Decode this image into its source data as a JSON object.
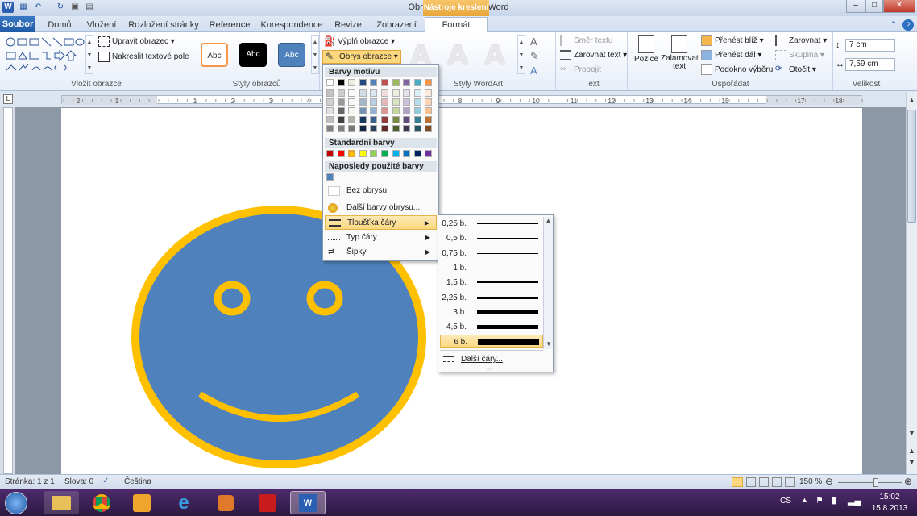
{
  "window": {
    "title": "Obrazek - Microsoft Word",
    "context_tab": "Nástroje kreslení"
  },
  "tabs": {
    "file": "Soubor",
    "items": [
      "Domů",
      "Vložení",
      "Rozložení stránky",
      "Reference",
      "Korespondence",
      "Revize",
      "Zobrazení",
      "Formát"
    ]
  },
  "ribbon": {
    "insert_shapes": {
      "edit_shape": "Upravit obrazec",
      "draw_textbox": "Nakreslit textové pole",
      "label": "Vložit obrazce"
    },
    "shape_styles": {
      "styles": [
        "Abc",
        "Abc",
        "Abc"
      ],
      "fill": "Výplň obrazce",
      "outline": "Obrys obrazce",
      "label": "Styly obrazců"
    },
    "wordart": {
      "letter": "A",
      "label": "Styly WordArt"
    },
    "text": {
      "direction": "Směr textu",
      "align": "Zarovnat text",
      "link": "Propojit",
      "label": "Text"
    },
    "arrange": {
      "position": "Pozice",
      "wrap": "Zalamovat text",
      "forward": "Přenést blíž",
      "backward": "Přenést dál",
      "pane": "Podokno výběru",
      "align": "Zarovnat",
      "group": "Skupina",
      "rotate": "Otočit",
      "label": "Uspořádat"
    },
    "size": {
      "height": "7 cm",
      "width": "7,59 cm",
      "label": "Velikost"
    }
  },
  "color_menu": {
    "theme_header": "Barvy motivu",
    "standard_header": "Standardní barvy",
    "recent_header": "Naposledy použité barvy",
    "no_outline": "Bez obrysu",
    "more_colors": "Další barvy obrysu...",
    "weight": "Tloušťka čáry",
    "dash": "Typ čáry",
    "arrows": "Šipky",
    "theme_colors": [
      "#ffffff",
      "#000000",
      "#eeece1",
      "#1f497d",
      "#4f81bd",
      "#c0504d",
      "#9bbb59",
      "#8064a2",
      "#4bacc6",
      "#f79646"
    ],
    "standard_colors": [
      "#c00000",
      "#ff0000",
      "#ffc000",
      "#ffff00",
      "#92d050",
      "#00b050",
      "#00b0f0",
      "#0070c0",
      "#002060",
      "#7030a0"
    ],
    "recent_colors": [
      "#4f81bd"
    ]
  },
  "weight_menu": {
    "items": [
      {
        "label": "0,25 b.",
        "w": 0.25
      },
      {
        "label": "0,5 b.",
        "w": 0.5
      },
      {
        "label": "0,75 b.",
        "w": 0.75
      },
      {
        "label": "1 b.",
        "w": 1
      },
      {
        "label": "1,5 b.",
        "w": 1.5
      },
      {
        "label": "2,25 b.",
        "w": 2.25
      },
      {
        "label": "3 b.",
        "w": 3
      },
      {
        "label": "4,5 b.",
        "w": 4.5
      },
      {
        "label": "6 b.",
        "w": 6
      }
    ],
    "selected": "6 b.",
    "more": "Další čáry..."
  },
  "ruler": {
    "marks": [
      "2",
      "1",
      "1",
      "2",
      "3",
      "4",
      "8",
      "9",
      "10",
      "11",
      "12",
      "13",
      "14",
      "15",
      "17",
      "18"
    ]
  },
  "status": {
    "page": "Stránka: 1 z 1",
    "words": "Slova: 0",
    "language": "Čeština",
    "zoom": "150 %"
  },
  "taskbar": {
    "lang": "CS",
    "time": "15:02",
    "date": "15.8.2013"
  },
  "drawing": {
    "face_fill": "#4f81bd",
    "outline": "#ffc000"
  }
}
